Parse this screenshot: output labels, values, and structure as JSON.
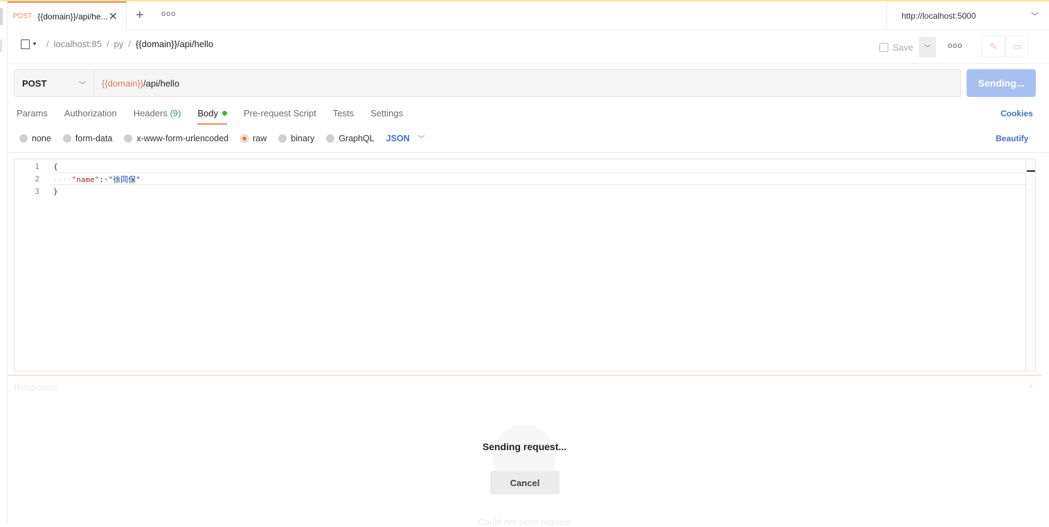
{
  "tabs": [
    {
      "method": "POST",
      "title": "{{domain}}/api/he..."
    }
  ],
  "environment": {
    "label": "http://localhost:5000"
  },
  "breadcrumb": {
    "workspace": "localhost:85",
    "folder": "py",
    "request": "{{domain}}/api/hello"
  },
  "toolbar": {
    "save_label": "Save"
  },
  "request": {
    "method": "POST",
    "url_var": "{{domain}}",
    "url_path": "/api/hello",
    "send_label": "Sending..."
  },
  "req_tabs": {
    "params": "Params",
    "authorization": "Authorization",
    "headers": "Headers",
    "headers_count": "(9)",
    "body": "Body",
    "prerequest": "Pre-request Script",
    "tests": "Tests",
    "settings": "Settings",
    "cookies": "Cookies"
  },
  "body_types": {
    "none": "none",
    "form_data": "form-data",
    "urlencoded": "x-www-form-urlencoded",
    "raw": "raw",
    "binary": "binary",
    "graphql": "GraphQL",
    "format": "JSON",
    "beautify": "Beautify"
  },
  "editor": {
    "line_numbers": [
      "1",
      "2",
      "3"
    ],
    "line1": "{",
    "line2_dots": "····",
    "line2_key": "\"name\"",
    "line2_colon": ":·",
    "line2_value": "\"徐同保\"",
    "line3": "}"
  },
  "response": {
    "title": "Response",
    "status": "Sending request...",
    "cancel_label": "Cancel",
    "ghost_text": "Could not send request"
  },
  "colors": {
    "accent": "#f08a5d",
    "link": "#4a6bd1",
    "send_disabled": "#a7c0f0"
  }
}
